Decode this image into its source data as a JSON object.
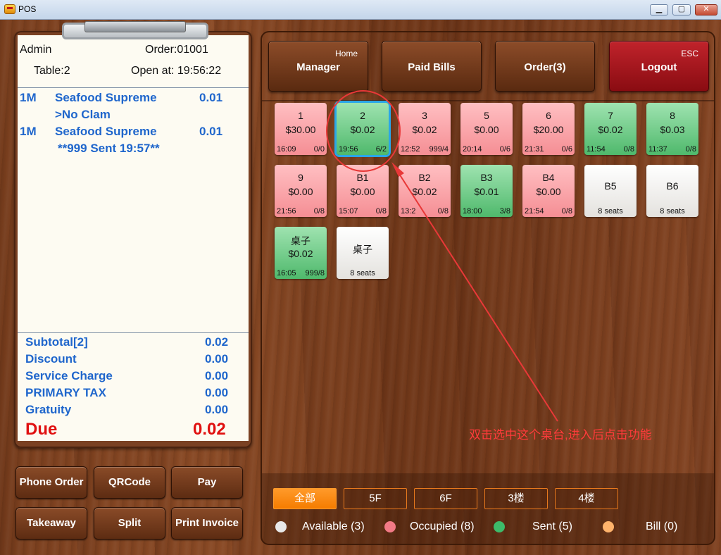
{
  "window": {
    "title": "POS",
    "min": "▁",
    "max": "▢",
    "close": "✕"
  },
  "receipt": {
    "user": "Admin",
    "order": "Order:01001",
    "table": "Table:2",
    "open_at": "Open at: 19:56:22",
    "lines": [
      {
        "qty": "1M",
        "name": "Seafood Supreme",
        "price": "0.01"
      },
      {
        "qty": "",
        "name": ">No Clam",
        "price": ""
      },
      {
        "qty": "1M",
        "name": "Seafood Supreme",
        "price": "0.01"
      },
      {
        "qty": "",
        "name": "**999 Sent 19:57**",
        "price": ""
      }
    ],
    "totals": [
      {
        "label": "Subtotal[2]",
        "value": "0.02"
      },
      {
        "label": "Discount",
        "value": "0.00"
      },
      {
        "label": "Service Charge",
        "value": "0.00"
      },
      {
        "label": "PRIMARY TAX",
        "value": "0.00"
      },
      {
        "label": "Gratuity",
        "value": "0.00"
      }
    ],
    "due_label": "Due",
    "due_value": "0.02"
  },
  "left_buttons": [
    "Phone Order",
    "QRCode",
    "Pay",
    "Takeaway",
    "Split",
    "Print Invoice"
  ],
  "top_buttons": [
    {
      "label": "Manager",
      "key": "Home"
    },
    {
      "label": "Paid Bills",
      "key": ""
    },
    {
      "label": "Order(3)",
      "key": ""
    },
    {
      "label": "Logout",
      "key": "ESC"
    }
  ],
  "tables": [
    {
      "name": "1",
      "amount": "$30.00",
      "time": "16:09",
      "seats": "0/0",
      "status": "occupied"
    },
    {
      "name": "2",
      "amount": "$0.02",
      "time": "19:56",
      "seats": "6/2",
      "status": "sent",
      "selected": true
    },
    {
      "name": "3",
      "amount": "$0.02",
      "time": "12:52",
      "seats": "999/4",
      "status": "occupied"
    },
    {
      "name": "5",
      "amount": "$0.00",
      "time": "20:14",
      "seats": "0/6",
      "status": "occupied"
    },
    {
      "name": "6",
      "amount": "$20.00",
      "time": "21:31",
      "seats": "0/6",
      "status": "occupied"
    },
    {
      "name": "7",
      "amount": "$0.02",
      "time": "11:54",
      "seats": "0/8",
      "status": "sent"
    },
    {
      "name": "8",
      "amount": "$0.03",
      "time": "11:37",
      "seats": "0/8",
      "status": "sent"
    },
    {
      "name": "9",
      "amount": "$0.00",
      "time": "21:56",
      "seats": "0/8",
      "status": "occupied"
    },
    {
      "name": "B1",
      "amount": "$0.00",
      "time": "15:07",
      "seats": "0/8",
      "status": "occupied"
    },
    {
      "name": "B2",
      "amount": "$0.02",
      "time": "13:2",
      "seats": "0/8",
      "status": "occupied"
    },
    {
      "name": "B3",
      "amount": "$0.01",
      "time": "18:00",
      "seats": "3/8",
      "status": "sent"
    },
    {
      "name": "B4",
      "amount": "$0.00",
      "time": "21:54",
      "seats": "0/8",
      "status": "occupied"
    },
    {
      "name": "B5",
      "seats_text": "8 seats",
      "status": "available"
    },
    {
      "name": "B6",
      "seats_text": "8 seats",
      "status": "available"
    },
    {
      "name": "桌子",
      "amount": "$0.02",
      "time": "16:05",
      "seats": "999/8",
      "status": "sent"
    },
    {
      "name": "桌子",
      "seats_text": "8 seats",
      "status": "available"
    }
  ],
  "annotation": "双击选中这个桌台,进入后点击功能",
  "floors": [
    "全部",
    "5F",
    "6F",
    "3楼",
    "4楼"
  ],
  "legend": [
    {
      "label": "Available (3)",
      "color": "#e8e8e8"
    },
    {
      "label": "Occupied (8)",
      "color": "#f27a86"
    },
    {
      "label": "Sent (5)",
      "color": "#3dbb6a"
    },
    {
      "label": "Bill (0)",
      "color": "#ffb36b"
    }
  ],
  "colors": {
    "available": "#f2f1ee",
    "occupied": "#f58e94",
    "sent": "#4fb96c",
    "selected": "#2aa6e8",
    "annotation": "#e83838"
  }
}
